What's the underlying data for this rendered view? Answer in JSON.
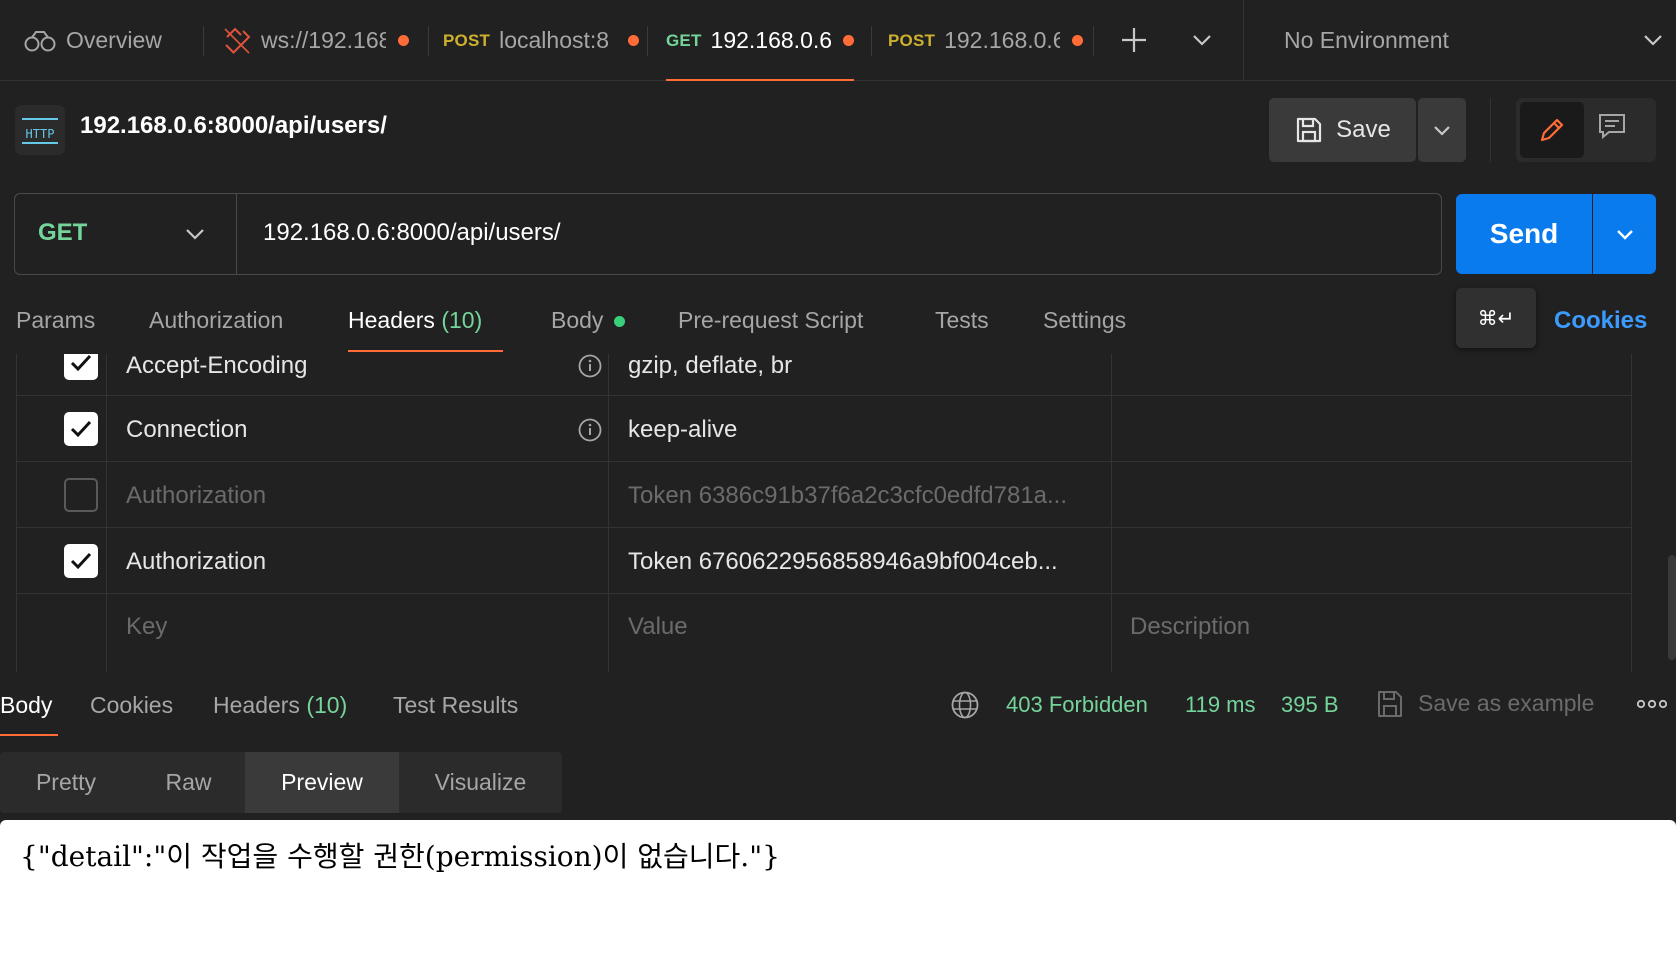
{
  "tabs": [
    {
      "label": "Overview",
      "icon": "overview-icon"
    },
    {
      "label": "ws://192.168",
      "icon": "websocket-icon",
      "unsaved": true
    },
    {
      "method": "POST",
      "label": "localhost:8",
      "unsaved": true
    },
    {
      "method": "GET",
      "label": "192.168.0.6:",
      "unsaved": true,
      "active": true
    },
    {
      "method": "POST",
      "label": "192.168.0.6",
      "unsaved": true
    }
  ],
  "environment": {
    "label": "No Environment"
  },
  "request": {
    "badge": "HTTP",
    "title": "192.168.0.6:8000/api/users/",
    "method": "GET",
    "url": "192.168.0.6:8000/api/users/"
  },
  "toolbar": {
    "save_label": "Save",
    "send_label": "Send",
    "send_shortcut": "⌘↵"
  },
  "request_tabs": {
    "params": "Params",
    "authorization": "Authorization",
    "headers": "Headers",
    "headers_count": "(10)",
    "body": "Body",
    "pre_request": "Pre-request Script",
    "tests": "Tests",
    "settings": "Settings",
    "cookies": "Cookies"
  },
  "headers_table": {
    "rows": [
      {
        "checked": true,
        "key": "Accept-Encoding",
        "value": "gzip, deflate, br",
        "info": true
      },
      {
        "checked": true,
        "key": "Connection",
        "value": "keep-alive",
        "info": true
      },
      {
        "checked": false,
        "key": "Authorization",
        "value": "Token 6386c91b37f6a2c3cfc0edfd781a..."
      },
      {
        "checked": true,
        "key": "Authorization",
        "value": "Token 6760622956858946a9bf004ceb..."
      }
    ],
    "placeholder_key": "Key",
    "placeholder_value": "Value",
    "placeholder_description": "Description"
  },
  "response": {
    "tabs": {
      "body": "Body",
      "cookies": "Cookies",
      "headers": "Headers",
      "headers_count": "(10)",
      "test_results": "Test Results"
    },
    "status": "403 Forbidden",
    "time": "119 ms",
    "size": "395 B",
    "save_example": "Save as example",
    "views": {
      "pretty": "Pretty",
      "raw": "Raw",
      "preview": "Preview",
      "visualize": "Visualize"
    },
    "preview_text": "{\"detail\":\"이 작업을 수행할 권한(permission)이 없습니다.\"}"
  },
  "colors": {
    "accent": "#ff6c37",
    "send": "#097bed",
    "get": "#75d49a",
    "post": "#ccb02e",
    "link": "#3b9bff"
  }
}
